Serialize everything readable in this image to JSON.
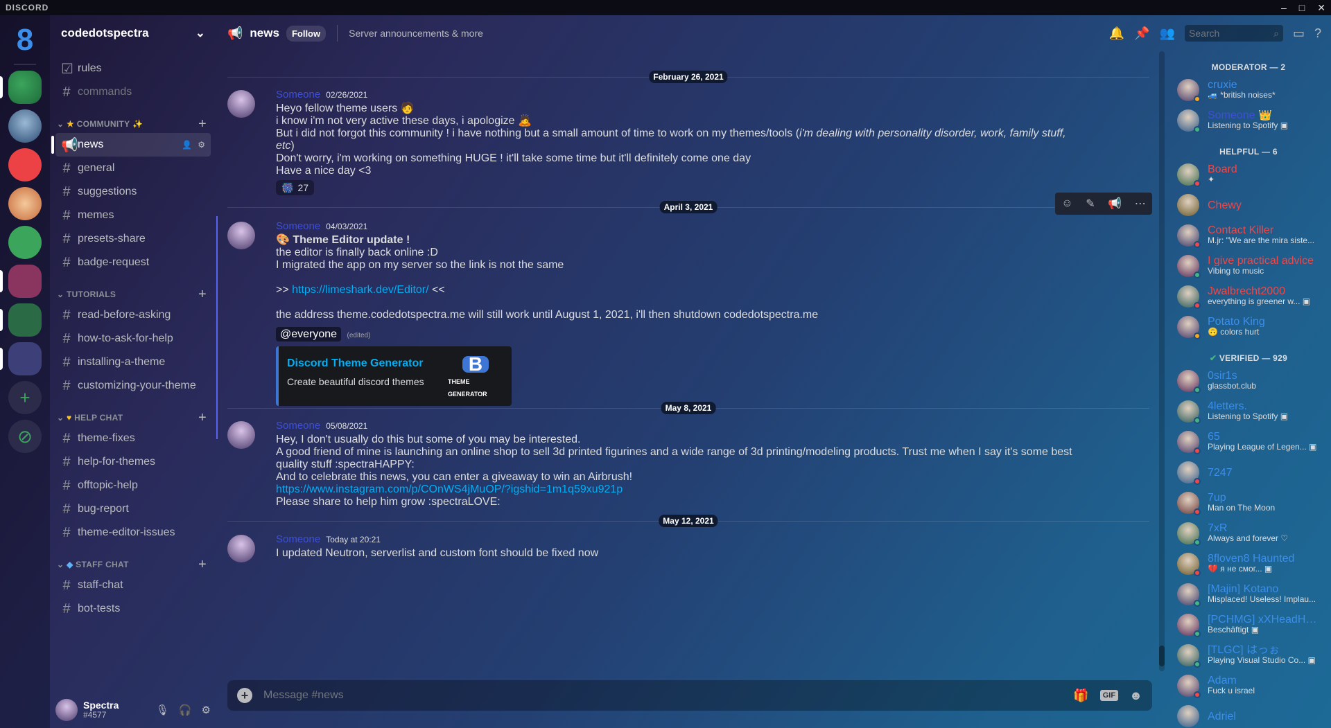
{
  "app": {
    "title": "DISCORD",
    "window_controls": [
      "–",
      "□",
      "✕"
    ]
  },
  "rail": {
    "home_label": "8",
    "add_label": "+",
    "explore_label": "⊘"
  },
  "guild": {
    "name": "codedotspectra"
  },
  "channels": {
    "top": [
      {
        "label": "rules",
        "icon": "checkbox-icon"
      },
      {
        "label": "commands",
        "icon": "hash-icon"
      }
    ],
    "categories": [
      {
        "name": "COMMUNITY",
        "prefix": "★",
        "suffix": "✨",
        "items": [
          "news",
          "general",
          "suggestions",
          "memes",
          "presets-share",
          "badge-request"
        ]
      },
      {
        "name": "TUTORIALS",
        "prefix": "",
        "suffix": "",
        "items": [
          "read-before-asking",
          "how-to-ask-for-help",
          "installing-a-theme",
          "customizing-your-theme"
        ]
      },
      {
        "name": "HELP CHAT",
        "prefix": "♥",
        "suffix": "",
        "items": [
          "theme-fixes",
          "help-for-themes",
          "offtopic-help",
          "bug-report",
          "theme-editor-issues"
        ]
      },
      {
        "name": "STAFF CHAT",
        "prefix": "◆",
        "suffix": "",
        "items": [
          "staff-chat",
          "bot-tests"
        ]
      }
    ]
  },
  "user": {
    "name": "Spectra",
    "tag": "#4577"
  },
  "chat_header": {
    "channel": "news",
    "follow_label": "Follow",
    "topic": "Server announcements & more",
    "search_placeholder": "Search"
  },
  "dates": [
    "February 26, 2021",
    "April 3, 2021",
    "May 8, 2021",
    "May 12, 2021"
  ],
  "messages": [
    {
      "author": "Someone",
      "time": "02/26/2021",
      "lines": [
        "Heyo fellow theme users 🧑",
        "i know i'm not very active these days, i apologize 🙇",
        "But i did not forgot this community ! i have nothing but a small amount of time to work on my themes/tools (",
        "i'm dealing with personality disorder, work, family stuff,",
        "etc",
        ")",
        "Don't worry, i'm working on something HUGE ! it'll take some time but it'll definitely come one day",
        "Have a nice day <3"
      ],
      "reaction": {
        "emoji": "🎆",
        "count": "27"
      }
    },
    {
      "author": "Someone",
      "time": "04/03/2021",
      "lines": [
        "Theme Editor update !",
        "the editor is finally back online :D",
        "I migrated the app on my server so the link is not the same",
        ">> ",
        "https://limeshark.dev/Editor/",
        " <<",
        "the address theme.codedotspectra.me will still work until August 1, 2021, i'll then shutdown codedotspectra.me"
      ],
      "mention": "@everyone",
      "edited": "(edited)",
      "embed": {
        "title": "Discord Theme Generator",
        "description": "Create beautiful discord themes",
        "thumb_logo": "B",
        "thumb_caption": "THEME GENERATOR"
      }
    },
    {
      "author": "Someone",
      "time": "05/08/2021",
      "lines": [
        "Hey, I don't usually do this but some of you may be interested.",
        "A good friend of mine is launching an online shop to sell 3d printed figurines and a wide range of 3d printing/modeling products. Trust me when I say it's some best",
        "quality stuff :spectraHAPPY:",
        "And to celebrate this news, you can enter a giveaway to win an Airbrush!",
        "https://www.instagram.com/p/COnWS4jMuOP/?igshid=1m1q59xu921p",
        "Please share to help him grow :spectraLOVE:"
      ]
    },
    {
      "author": "Someone",
      "time": "Today at 20:21",
      "lines": [
        "I updated Neutron, serverlist and custom font should be fixed now"
      ]
    }
  ],
  "composer": {
    "placeholder": "Message #news"
  },
  "members": {
    "groups": [
      {
        "title": "MODERATOR — 2",
        "items": [
          {
            "name": "cruxie",
            "activity": "🚙 *british noises*",
            "color": "#3b8eea",
            "status": "#faa61a"
          },
          {
            "name": "Someone 👑",
            "activity": "Listening to Spotify ▣",
            "color": "#3e4fd6",
            "status": "#43b581"
          }
        ]
      },
      {
        "title": "HELPFUL — 6",
        "items": [
          {
            "name": "Board",
            "activity": "✦",
            "color": "#f04747",
            "status": "#f04747"
          },
          {
            "name": "Chewy",
            "activity": "",
            "color": "#f04747",
            "status": ""
          },
          {
            "name": "Contact Killer",
            "activity": "M.jr: \"We are the mira siste...",
            "color": "#f04747",
            "status": "#f04747"
          },
          {
            "name": "I give practical advice",
            "activity": "Vibing to music",
            "color": "#f04747",
            "status": "#43b581"
          },
          {
            "name": "Jwalbrecht2000",
            "activity": "everything is greener w... ▣",
            "color": "#f04747",
            "status": "#f04747"
          },
          {
            "name": "Potato King",
            "activity": "🙃 colors hurt",
            "color": "#3b8eea",
            "status": "#faa61a"
          }
        ]
      },
      {
        "title": "VERIFIED — 929",
        "prefix": "✔",
        "items": [
          {
            "name": "0sir1s",
            "activity": "glassbot.club",
            "color": "#3b8eea",
            "status": "#43b581"
          },
          {
            "name": "4letters.",
            "activity": "Listening to Spotify ▣",
            "color": "#3b8eea",
            "status": "#43b581"
          },
          {
            "name": "65",
            "activity": "Playing League of Legen... ▣",
            "color": "#3b8eea",
            "status": "#f04747"
          },
          {
            "name": "7247",
            "activity": "",
            "color": "#3b8eea",
            "status": "#f04747"
          },
          {
            "name": "7up",
            "activity": "Man on The Moon",
            "color": "#3b8eea",
            "status": "#f04747"
          },
          {
            "name": "7xR",
            "activity": "Always and forever ♡",
            "color": "#3b8eea",
            "status": "#43b581"
          },
          {
            "name": "8floven8 Haunted",
            "activity": "💔 я не смог... ▣",
            "color": "#3b8eea",
            "status": "#f04747"
          },
          {
            "name": "[Majin] Kotano",
            "activity": "Misplaced! Useless! Implau...",
            "color": "#3b8eea",
            "status": "#43b581"
          },
          {
            "name": "[PCHMG] xXHeadHu...",
            "activity": "Beschäftigt ▣",
            "color": "#3b8eea",
            "status": "#43b581"
          },
          {
            "name": "[TLGC] はっぉ",
            "activity": "Playing Visual Studio Co... ▣",
            "color": "#3b8eea",
            "status": "#43b581"
          },
          {
            "name": "Adam",
            "activity": "Fuck u israel",
            "color": "#3b8eea",
            "status": "#f04747"
          },
          {
            "name": "Adriel",
            "activity": "",
            "color": "#3b8eea",
            "status": ""
          }
        ]
      }
    ]
  }
}
